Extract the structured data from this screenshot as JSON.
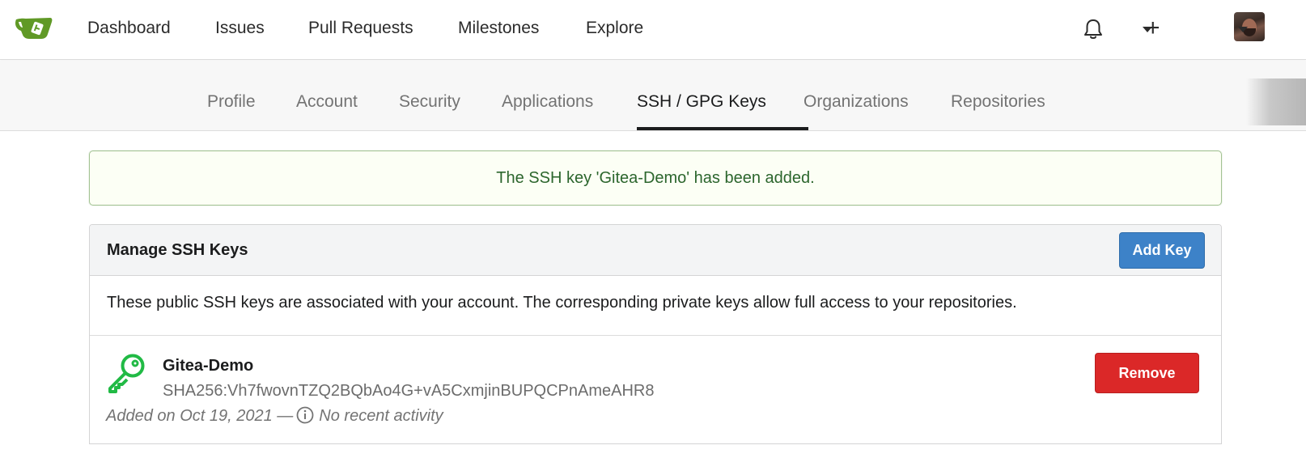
{
  "topnav": {
    "logo": "gitea-logo",
    "links": [
      "Dashboard",
      "Issues",
      "Pull Requests",
      "Milestones",
      "Explore"
    ],
    "icons": [
      "bell-icon",
      "plus-icon",
      "chevron-down-icon"
    ]
  },
  "settings_tabs": {
    "items": [
      "Profile",
      "Account",
      "Security",
      "Applications",
      "SSH / GPG Keys",
      "Organizations",
      "Repositories"
    ],
    "active": "SSH / GPG Keys"
  },
  "flash": {
    "message": "The SSH key 'Gitea-Demo' has been added.",
    "color": "#2c662d"
  },
  "ssh_panel": {
    "title": "Manage SSH Keys",
    "add_button": "Add Key",
    "description": "These public SSH keys are associated with your account. The corresponding private keys allow full access to your repositories.",
    "keys": [
      {
        "name": "Gitea-Demo",
        "fingerprint": "SHA256:Vh7fwovnTZQ2BQbAo4G+vA5CxmjinBUPQCPnAmeAHR8",
        "added": "Added on Oct 19, 2021 —",
        "activity": "No recent activity",
        "remove_label": "Remove",
        "icon_color": "#21ba45"
      }
    ]
  },
  "colors": {
    "primary": "#3d82c8",
    "danger": "#db2828",
    "success_bg": "#fcfff5"
  }
}
